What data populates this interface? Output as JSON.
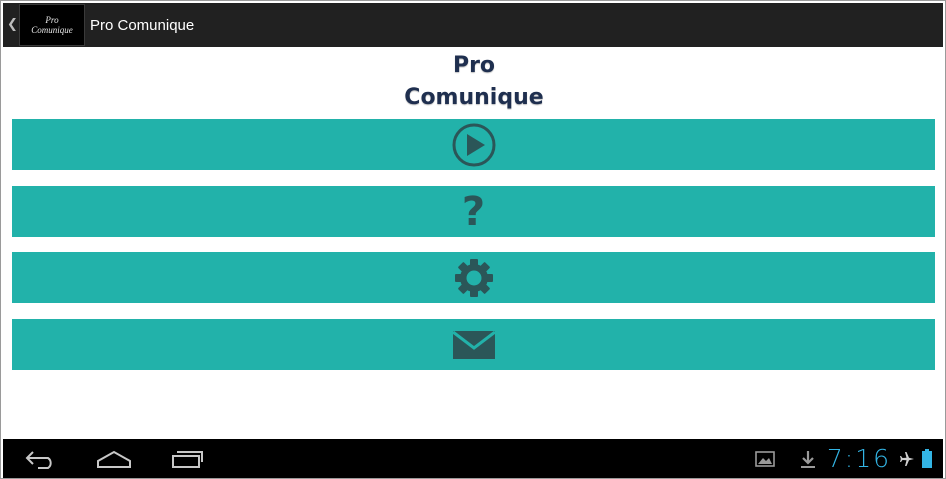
{
  "action_bar": {
    "logo_line1": "Pro",
    "logo_line2": "Comunique",
    "title": "Pro Comunique",
    "back_icon": "chevron-left-icon"
  },
  "main": {
    "title_line1": "Pro",
    "title_line2": "Comunique",
    "buttons": [
      {
        "name": "play-button",
        "icon": "play-circle-icon"
      },
      {
        "name": "help-button",
        "icon": "question-mark-icon",
        "glyph": "?"
      },
      {
        "name": "settings-button",
        "icon": "gear-icon"
      },
      {
        "name": "mail-button",
        "icon": "envelope-icon"
      }
    ]
  },
  "system_bar": {
    "nav": [
      "back-icon",
      "home-icon",
      "recent-apps-icon"
    ],
    "status_icons": [
      "gallery-icon",
      "download-icon",
      "airplane-icon",
      "battery-icon"
    ],
    "clock": "7:16"
  },
  "colors": {
    "action_bar": "#212121",
    "button_teal": "#22b2aa",
    "icon_dark": "#2b5658",
    "title_navy": "#1f2f4f",
    "clock_blue": "#33b5e5"
  }
}
